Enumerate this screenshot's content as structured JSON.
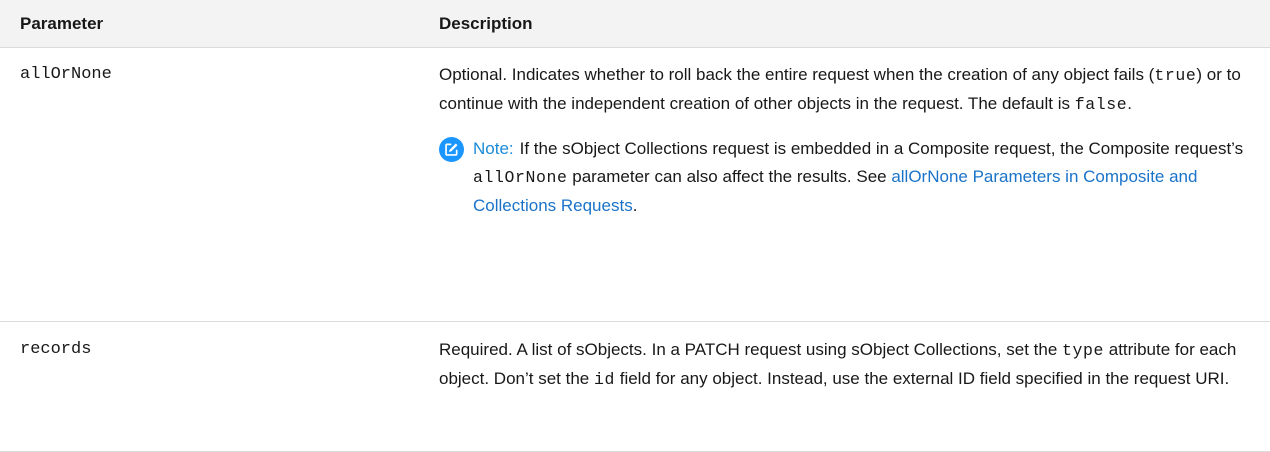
{
  "table": {
    "headers": {
      "parameter": "Parameter",
      "description": "Description"
    },
    "rows": [
      {
        "name": "allOrNone",
        "desc_parts": [
          "Optional. Indicates whether to roll back the entire request when the creation of any object fails (",
          "true",
          ") or to continue with the independent creation of other objects in the request. The default is ",
          "false",
          "."
        ],
        "note": {
          "icon": "edit-note-icon",
          "label": "Note:",
          "parts": [
            "If the sObject Collections request is embedded in a Composite request, the Composite request’s ",
            "allOrNone",
            " parameter can also affect the results. See ",
            "."
          ],
          "link_text": "allOrNone Parameters in Composite and Collections Requests"
        }
      },
      {
        "name": "records",
        "desc_parts": [
          "Required. A list of sObjects. In a PATCH request using sObject Collections, set the ",
          "type",
          " attribute for each object. Don’t set the ",
          "id",
          " field for any object. Instead, use the external ID field specified in the request URI."
        ]
      }
    ]
  },
  "colors": {
    "header_bg": "#f3f3f3",
    "note_icon": "#1b96ff",
    "link": "#1a73c9"
  }
}
